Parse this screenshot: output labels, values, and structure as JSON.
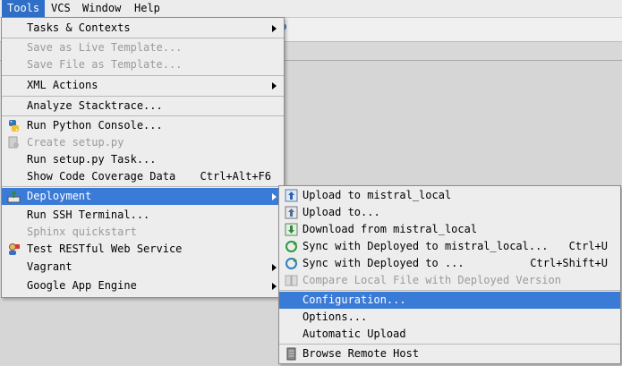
{
  "menubar": {
    "items": [
      {
        "label": "Tools"
      },
      {
        "label": "VCS"
      },
      {
        "label": "Window"
      },
      {
        "label": "Help"
      }
    ]
  },
  "tools_menu": {
    "items": [
      {
        "label": "Tasks & Contexts",
        "icon": "none",
        "enabled": true,
        "submenu": true
      },
      {
        "label": "Save as Live Template...",
        "icon": "none",
        "enabled": false
      },
      {
        "label": "Save File as Template...",
        "icon": "none",
        "enabled": false
      },
      {
        "label": "XML Actions",
        "icon": "none",
        "enabled": true,
        "submenu": true
      },
      {
        "label": "Analyze Stacktrace...",
        "icon": "none",
        "enabled": true
      },
      {
        "label": "Run Python Console...",
        "icon": "python-icon",
        "enabled": true
      },
      {
        "label": "Create setup.py",
        "icon": "setup-py-icon",
        "enabled": false
      },
      {
        "label": "Run setup.py Task...",
        "icon": "none",
        "enabled": true
      },
      {
        "label": "Show Code Coverage Data",
        "shortcut": "Ctrl+Alt+F6",
        "icon": "none",
        "enabled": true
      },
      {
        "label": "Deployment",
        "icon": "deployment-icon",
        "enabled": true,
        "submenu": true,
        "selected": true
      },
      {
        "label": "Run SSH Terminal...",
        "icon": "none",
        "enabled": true
      },
      {
        "label": "Sphinx quickstart",
        "icon": "none",
        "enabled": false
      },
      {
        "label": "Test RESTful Web Service",
        "icon": "rest-client-icon",
        "enabled": true
      },
      {
        "label": "Vagrant",
        "icon": "none",
        "enabled": true,
        "submenu": true
      },
      {
        "label": "Google App Engine",
        "icon": "none",
        "enabled": true,
        "submenu": true
      }
    ]
  },
  "deployment_menu": {
    "items": [
      {
        "label": "Upload to mistral_local",
        "icon": "upload-icon",
        "enabled": true
      },
      {
        "label": "Upload to...",
        "icon": "upload-to-icon",
        "enabled": true
      },
      {
        "label": "Download from mistral_local",
        "icon": "download-icon",
        "enabled": true
      },
      {
        "label": "Sync with Deployed to mistral_local...",
        "shortcut": "Ctrl+U",
        "icon": "sync-icon",
        "enabled": true
      },
      {
        "label": "Sync with Deployed to ...",
        "shortcut": "Ctrl+Shift+U",
        "icon": "sync-to-icon",
        "enabled": true
      },
      {
        "label": "Compare Local File with Deployed Version",
        "icon": "compare-icon",
        "enabled": false
      },
      {
        "label": "Configuration...",
        "icon": "none",
        "enabled": true,
        "selected": true
      },
      {
        "label": "Options...",
        "icon": "none",
        "enabled": true
      },
      {
        "label": "Automatic Upload",
        "icon": "none",
        "enabled": true
      },
      {
        "label": "Browse Remote Host",
        "icon": "remote-host-icon",
        "enabled": true
      }
    ]
  },
  "colors": {
    "selection": "#3b7bd8",
    "menu_bg": "#ededed",
    "disabled_text": "#9a9a9a"
  }
}
